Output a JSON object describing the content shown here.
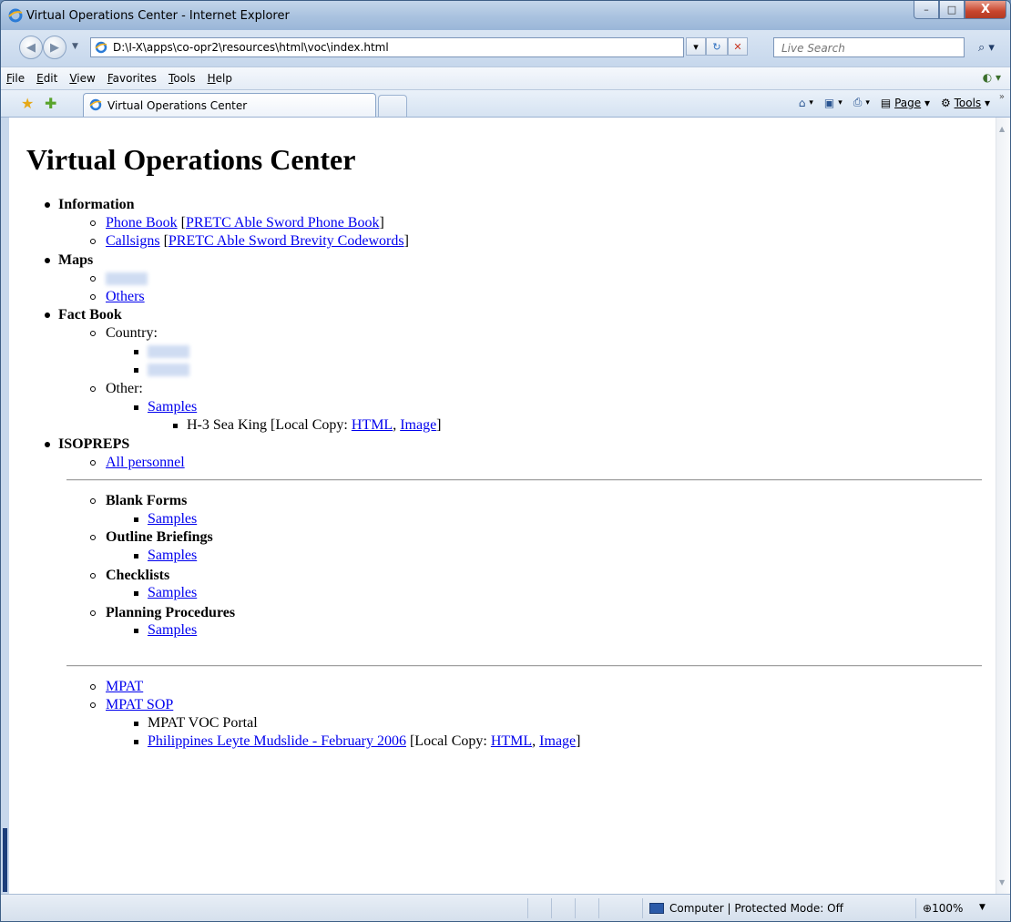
{
  "window": {
    "title": "Virtual Operations Center - Internet Explorer",
    "caption_buttons": {
      "minimize": "–",
      "maximize": "□",
      "close": "X"
    }
  },
  "address_bar": {
    "url": "D:\\I-X\\apps\\co-opr2\\resources\\html\\voc\\index.html",
    "search_placeholder": "Live Search"
  },
  "menu": {
    "items": [
      "File",
      "Edit",
      "View",
      "Favorites",
      "Tools",
      "Help"
    ]
  },
  "tab": {
    "label": "Virtual Operations Center"
  },
  "command_bar": {
    "page_label": "Page",
    "tools_label": "Tools"
  },
  "page": {
    "title": "Virtual Operations Center",
    "information": {
      "label": "Information",
      "phone_book": "Phone Book",
      "phone_book_extra": "PRETC Able Sword Phone Book",
      "callsigns": "Callsigns",
      "callsigns_extra": "PRETC Able Sword Brevity Codewords"
    },
    "maps": {
      "label": "Maps",
      "others": "Others"
    },
    "fact_book": {
      "label": "Fact Book",
      "country": "Country:",
      "other": "Other:",
      "samples": "Samples",
      "h3_text": "H-3 Sea King [Local Copy: ",
      "html_link": "HTML",
      "image_link": "Image",
      "close_bracket": "]"
    },
    "isopreps": {
      "label": "ISOPREPS",
      "all_personnel": "All personnel"
    },
    "blank_forms": {
      "label": "Blank Forms",
      "samples": "Samples"
    },
    "outline_briefings": {
      "label": "Outline Briefings",
      "samples": "Samples"
    },
    "checklists": {
      "label": "Checklists",
      "samples": "Samples"
    },
    "planning_procedures": {
      "label": "Planning Procedures",
      "samples": "Samples"
    },
    "mpat": "MPAT",
    "mpat_sop": "MPAT SOP",
    "mpat_voc_portal": "MPAT VOC Portal",
    "philippines": "Philippines Leyte Mudslide - February 2006",
    "philippines_local": " [Local Copy: ",
    "philippines_html": "HTML",
    "philippines_image": "Image"
  },
  "status_bar": {
    "zone": "Computer | Protected Mode: Off",
    "zoom": "100%"
  }
}
